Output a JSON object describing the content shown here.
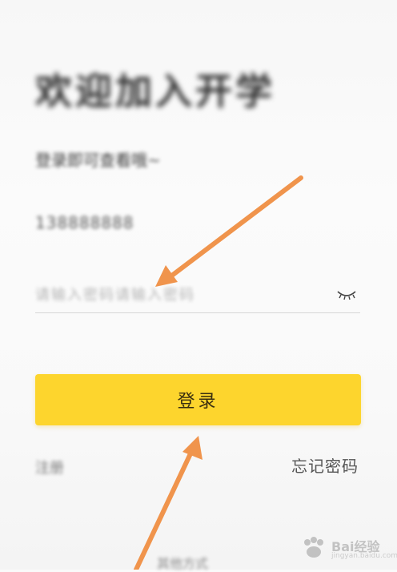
{
  "login": {
    "title": "欢迎加入开学",
    "subtitle": "登录即可查看哦~",
    "phone_value": "138888888",
    "password_placeholder": "请输入密码请输入密码",
    "login_label": "登录",
    "register_label": "注册",
    "forgot_label": "忘记密码",
    "bottom_text": "其他方式"
  },
  "icons": {
    "eye": "eye-closed-icon",
    "arrow": "arrow-icon",
    "paw": "paw-icon"
  },
  "watermark": {
    "brand": "Bai经验",
    "url": "jingyan.baidu.com"
  },
  "colors": {
    "button": "#fdd52d",
    "arrow": "#f0944c"
  }
}
